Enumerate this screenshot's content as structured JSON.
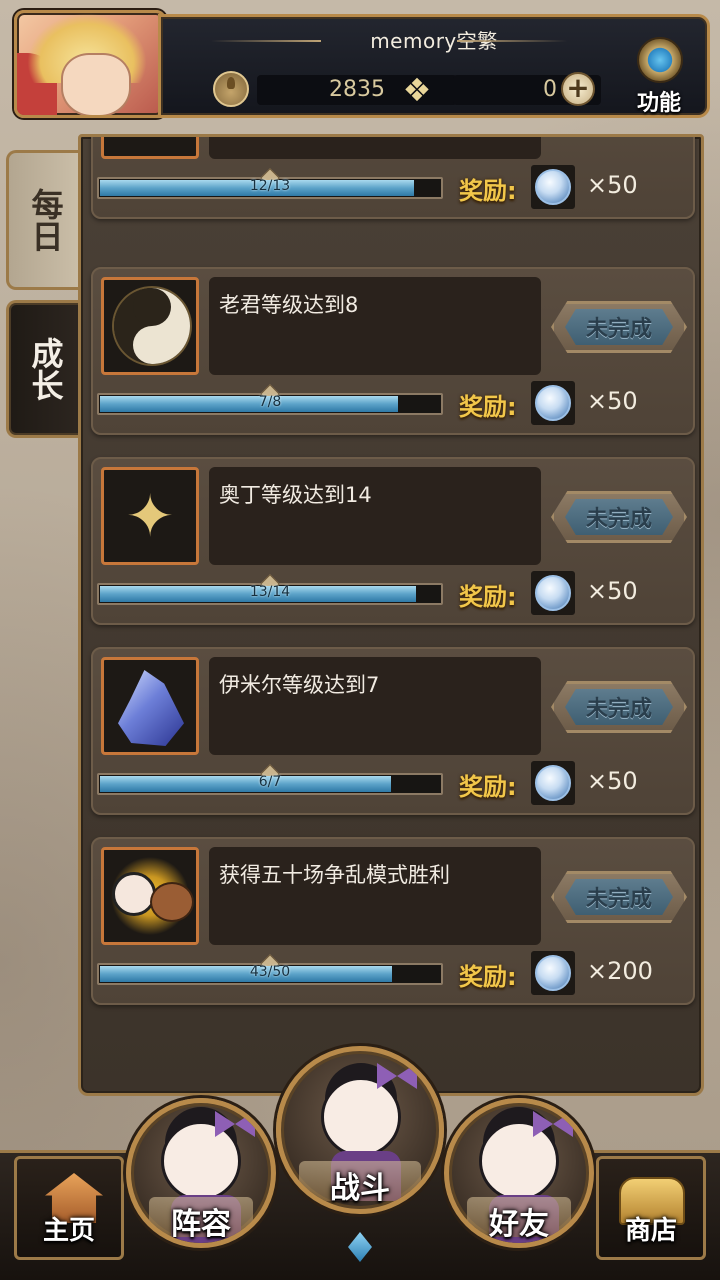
{
  "header": {
    "player_name": "memory空繁",
    "stamina_value": "2835",
    "gem_value": "0",
    "menu_label": "功能"
  },
  "tabs": {
    "daily": "每日",
    "growth": "成长"
  },
  "status_label": "未完成",
  "reward_label": "奖励:",
  "tasks": [
    {
      "title": "",
      "progress_text": "12/13",
      "progress": 0.923,
      "reward": "×50",
      "icon": "fire-creature-icon"
    },
    {
      "title": "老君等级达到8",
      "progress_text": "7/8",
      "progress": 0.875,
      "reward": "×50",
      "icon": "yin-yang-icon"
    },
    {
      "title": "奥丁等级达到14",
      "progress_text": "13/14",
      "progress": 0.929,
      "reward": "×50",
      "icon": "golden-wings-icon"
    },
    {
      "title": "伊米尔等级达到7",
      "progress_text": "6/7",
      "progress": 0.857,
      "reward": "×50",
      "icon": "ice-crystal-icon"
    },
    {
      "title": "获得五十场争乱模式胜利",
      "progress_text": "43/50",
      "progress": 0.86,
      "reward": "×200",
      "icon": "chibi-bear-icon"
    }
  ],
  "nav": {
    "home": "主页",
    "team": "阵容",
    "battle": "战斗",
    "friends": "好友",
    "shop": "商店"
  },
  "colors": {
    "frame_gold": "#b88a4a",
    "reward_gold": "#f2c74a",
    "progress_blue": "#5ca3c9",
    "status_blue": "#3f5f72"
  }
}
